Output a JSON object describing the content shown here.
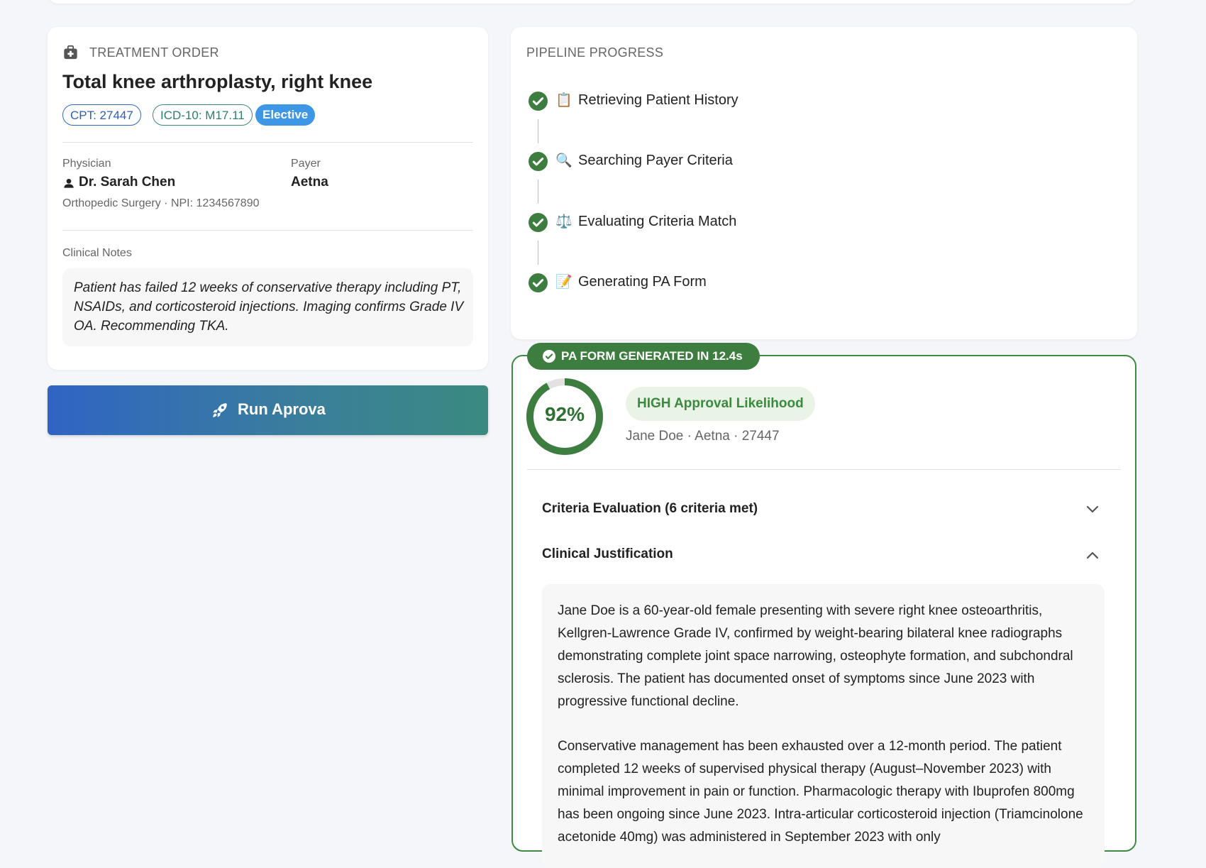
{
  "treatment": {
    "section_label": "TREATMENT ORDER",
    "procedure": "Total knee arthroplasty, right knee",
    "chips": {
      "cpt": "CPT: 27447",
      "icd": "ICD-10: M17.11",
      "priority": "Elective"
    },
    "physician_label": "Physician",
    "physician_name": "Dr. Sarah Chen",
    "physician_detail": "Orthopedic Surgery · NPI: 1234567890",
    "payer_label": "Payer",
    "payer_name": "Aetna",
    "notes_label": "Clinical Notes",
    "notes_text": "Patient has failed 12 weeks of conservative therapy including PT, NSAIDs, and corticosteroid injections. Imaging confirms Grade IV OA. Recommending TKA."
  },
  "run_button": {
    "label": "Run Aprova"
  },
  "pipeline": {
    "section_label": "PIPELINE PROGRESS",
    "steps": [
      {
        "emoji": "📋",
        "label": "Retrieving Patient History",
        "status": "complete"
      },
      {
        "emoji": "🔍",
        "label": "Searching Payer Criteria",
        "status": "complete"
      },
      {
        "emoji": "⚖️",
        "label": "Evaluating Criteria Match",
        "status": "complete"
      },
      {
        "emoji": "📝",
        "label": "Generating PA Form",
        "status": "complete"
      }
    ]
  },
  "result": {
    "badge": "PA FORM GENERATED IN 12.4s",
    "score_label": "92%",
    "score_value": 0.92,
    "likelihood": "HIGH Approval Likelihood",
    "meta": "Jane Doe · Aetna · 27447",
    "accordion_criteria": "Criteria Evaluation (6 criteria met)",
    "accordion_justification": "Clinical Justification",
    "justification_p1": "Jane Doe is a 60-year-old female presenting with severe right knee osteoarthritis, Kellgren-Lawrence Grade IV, confirmed by weight-bearing bilateral knee radiographs demonstrating complete joint space narrowing, osteophyte formation, and subchondral sclerosis. The patient has documented onset of symptoms since June 2023 with progressive functional decline.",
    "justification_p2": "Conservative management has been exhausted over a 12-month period. The patient completed 12 weeks of supervised physical therapy (August–November 2023) with minimal improvement in pain or function. Pharmacologic therapy with Ibuprofen 800mg has been ongoing since June 2023. Intra-articular corticosteroid injection (Triamcinolone acetonide 40mg) was administered in September 2023 with only"
  },
  "colors": {
    "success": "#3d7d3f",
    "accent_blue": "#3064c4",
    "accent_teal": "#3a8a80"
  }
}
